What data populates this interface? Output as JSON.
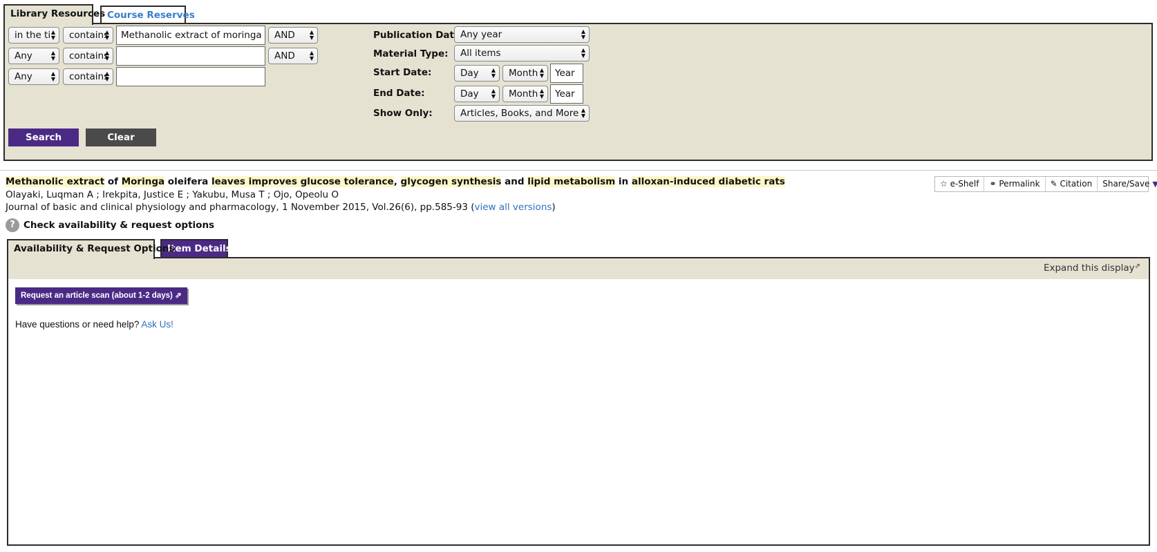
{
  "search_tabs": {
    "library_resources": "Library Resources",
    "course_reserves": "Course Reserves"
  },
  "search_rows": [
    {
      "field": "in the ti",
      "op": "contains",
      "value": "Methanolic extract of moringa leave",
      "bool": "AND"
    },
    {
      "field": "Any",
      "op": "contains",
      "value": "",
      "bool": "AND"
    },
    {
      "field": "Any",
      "op": "contains",
      "value": ""
    }
  ],
  "filters": {
    "publication_date_label": "Publication Date:",
    "publication_date": "Any year",
    "material_type_label": "Material Type:",
    "material_type": "All items",
    "start_date_label": "Start Date:",
    "end_date_label": "End Date:",
    "day": "Day",
    "month": "Month",
    "year": "Year",
    "show_only_label": "Show Only:",
    "show_only": "Articles, Books, and More"
  },
  "buttons": {
    "search": "Search",
    "clear": "Clear"
  },
  "result": {
    "title_parts": [
      "Methanolic extract",
      " of ",
      "Moringa",
      " oleifera ",
      "leaves improves glucose tolerance",
      ", ",
      "glycogen synthesis",
      " and ",
      "lipid metabolism",
      " in ",
      "alloxan-induced diabetic rats"
    ],
    "authors": "Olayaki, Luqman A ; Irekpita, Justice E ; Yakubu, Musa T ; Ojo, Opeolu O",
    "journal": "Journal of basic and clinical physiology and pharmacology, 1 November 2015, Vol.26(6), pp.585-93 (",
    "view_all_versions": "view all versions",
    "journal_close": ")",
    "availability": "Check availability & request options"
  },
  "actions": {
    "eshelf": "e-Shelf",
    "permalink": "Permalink",
    "citation": "Citation",
    "share": "Share/Save"
  },
  "detail_tabs": {
    "availability": "Availability & Request Options",
    "item_details": "Item Details"
  },
  "detail": {
    "expand": "Expand this display",
    "request_scan": "Request an article scan (about 1-2 days)",
    "help_text": "Have questions or need help? ",
    "ask_us": "Ask Us!"
  }
}
